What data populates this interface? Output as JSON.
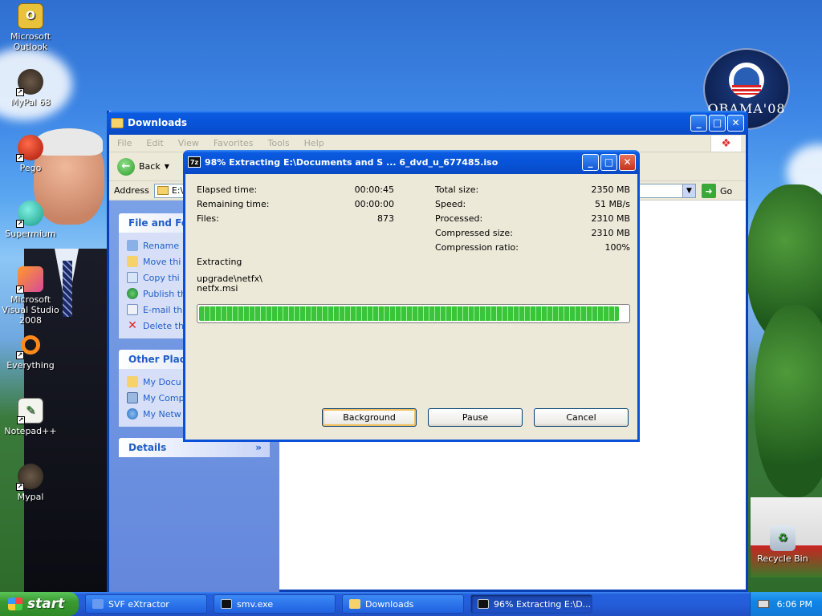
{
  "desktop": {
    "icons": [
      {
        "label": "Microsoft Outlook"
      },
      {
        "label": "MyPal 68"
      },
      {
        "label": "Pego"
      },
      {
        "label": "Supermium"
      },
      {
        "label": "Microsoft Visual Studio 2008"
      },
      {
        "label": "Everything"
      },
      {
        "label": "Notepad++"
      },
      {
        "label": "Mypal"
      },
      {
        "label": "Recycle Bin"
      }
    ],
    "badge_text": "OBAMA'08"
  },
  "explorer": {
    "title": "Downloads",
    "menu": [
      "File",
      "Edit",
      "View",
      "Favorites",
      "Tools",
      "Help"
    ],
    "back_label": "Back",
    "address_label": "Address",
    "address_value": "E:\\D",
    "go_label": "Go",
    "file_tasks": {
      "header": "File and Fold",
      "items": [
        "Rename",
        "Move thi",
        "Copy thi",
        "Publish th",
        "E-mail th",
        "Delete th"
      ]
    },
    "other_places": {
      "header": "Other Place",
      "items": [
        "My Docu",
        "My Comp",
        "My Netw"
      ]
    },
    "details_header": "Details"
  },
  "dialog": {
    "title": "98% Extracting E:\\Documents and S ... 6_dvd_u_677485.iso",
    "app_icon": "7z",
    "left_stats": [
      {
        "label": "Elapsed time:",
        "value": "00:00:45"
      },
      {
        "label": "Remaining time:",
        "value": "00:00:00"
      },
      {
        "label": "Files:",
        "value": "873"
      }
    ],
    "right_stats": [
      {
        "label": "Total size:",
        "value": "2350 MB"
      },
      {
        "label": "Speed:",
        "value": "51 MB/s"
      },
      {
        "label": "Processed:",
        "value": "2310 MB"
      },
      {
        "label": "Compressed size:",
        "value": "2310 MB"
      },
      {
        "label": "Compression ratio:",
        "value": "100%"
      }
    ],
    "status": "Extracting",
    "path_line1": "upgrade\\netfx\\",
    "path_line2": "netfx.msi",
    "progress": 0.98,
    "buttons": {
      "background": "Background",
      "pause": "Pause",
      "cancel": "Cancel"
    }
  },
  "taskbar": {
    "start": "start",
    "items": [
      {
        "label": "SVF eXtractor",
        "active": false
      },
      {
        "label": "smv.exe",
        "active": false
      },
      {
        "label": "Downloads",
        "active": false
      },
      {
        "label": "96% Extracting E:\\D...",
        "active": true
      }
    ],
    "clock": "6:06 PM"
  }
}
